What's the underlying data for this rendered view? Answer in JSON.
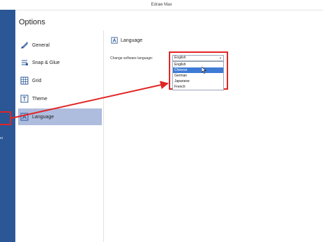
{
  "window": {
    "title": "Edraw Max"
  },
  "options": {
    "heading": "Options"
  },
  "sidebar_left": {
    "fragment": "er"
  },
  "nav": {
    "items": [
      {
        "label": "General",
        "icon": "general-icon"
      },
      {
        "label": "Snap & Glue",
        "icon": "snap-icon"
      },
      {
        "label": "Grid",
        "icon": "grid-icon"
      },
      {
        "label": "Theme",
        "icon": "theme-icon"
      },
      {
        "label": "Language",
        "icon": "language-icon",
        "active": true
      }
    ]
  },
  "language": {
    "section_title": "Language",
    "change_label": "Change software language:",
    "selected": "English",
    "options": [
      "English",
      "Chinese",
      "German",
      "Japanese",
      "French"
    ],
    "highlighted": "Chinese"
  },
  "colors": {
    "accent": "#3d7bd6",
    "active_nav": "#aebcde",
    "annotation_red": "#e22424",
    "left_strip": "#2b5797"
  }
}
